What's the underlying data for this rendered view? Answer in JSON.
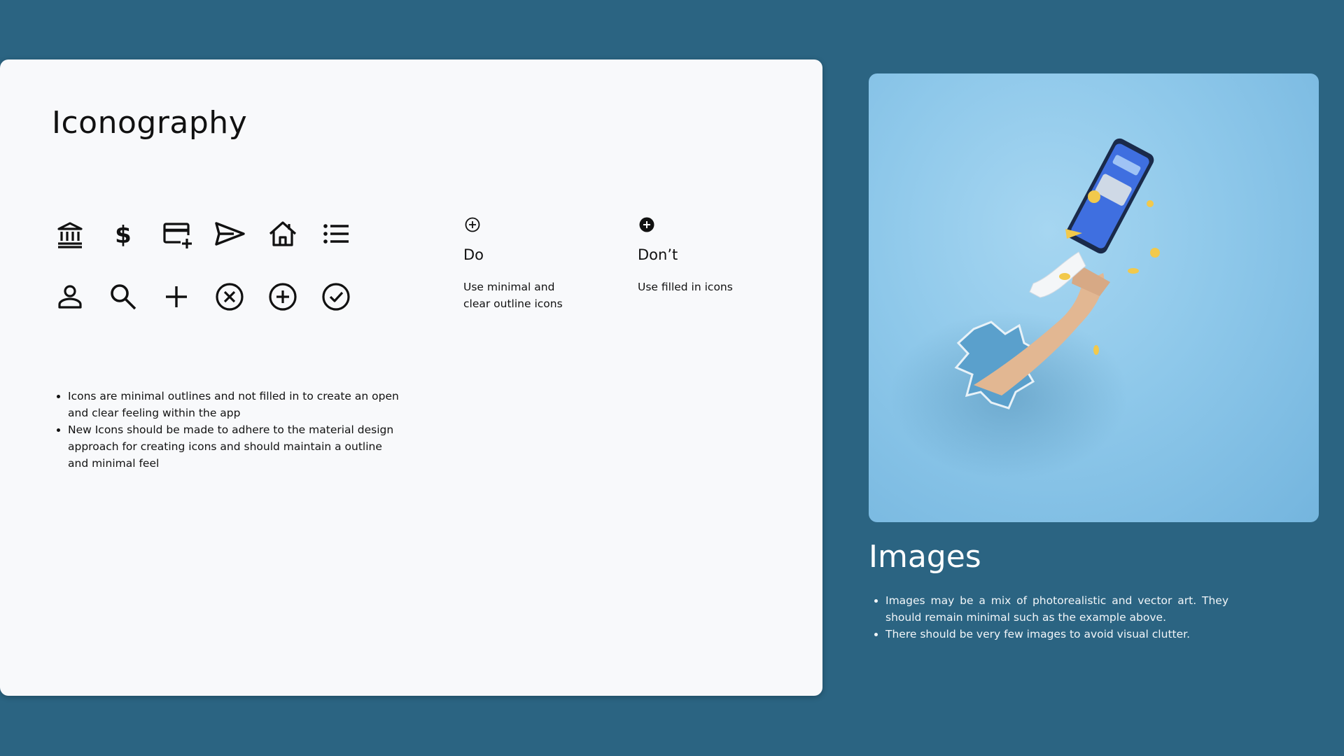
{
  "iconography": {
    "title": "Iconography",
    "icons_row1": [
      "bank-icon",
      "dollar-icon",
      "add-card-icon",
      "send-icon",
      "home-icon",
      "list-icon"
    ],
    "icons_row2": [
      "person-icon",
      "search-icon",
      "plus-icon",
      "cancel-circle-icon",
      "add-circle-outline-icon",
      "check-circle-icon"
    ],
    "do": {
      "icon": "add-circle-outline-icon",
      "heading": "Do",
      "description": "Use minimal and clear outline icons"
    },
    "dont": {
      "icon": "add-circle-filled-icon",
      "heading": "Don’t",
      "description": "Use filled in icons"
    },
    "bullets": [
      "Icons are minimal outlines and not filled in to create an open and clear feeling within the app",
      "New Icons should be made to adhere to the material design approach for creating icons and should maintain a outline and minimal feel"
    ]
  },
  "images": {
    "title": "Images",
    "bullets": [
      "Images may be a mix of photorealistic and vector art. They should remain minimal such as the example above.",
      "There should be very few images to avoid visual clutter."
    ]
  },
  "colors": {
    "background": "#2b6482",
    "card": "#f8f9fb",
    "icon": "#111111",
    "photo_bg": "#8ec8ea"
  }
}
